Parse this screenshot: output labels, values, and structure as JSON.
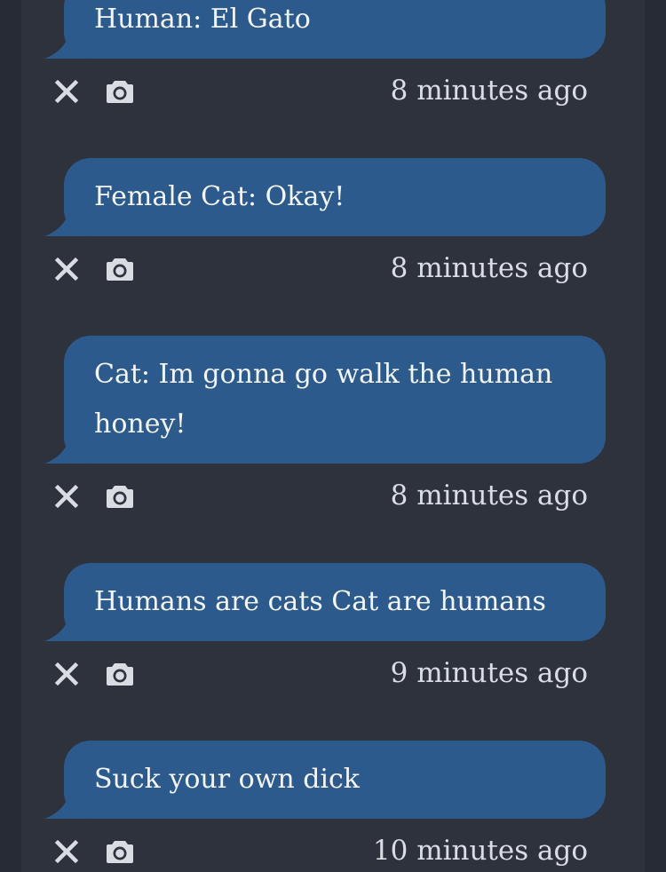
{
  "colors": {
    "background": "#272b35",
    "column": "#2e323d",
    "bubble": "#2c5a8c",
    "message_text": "#f4f5f8",
    "meta_text": "#dadde4",
    "icon": "#d9dce3"
  },
  "icons": {
    "delete": "close-icon",
    "photo": "camera-icon"
  },
  "messages": [
    {
      "text": "Human: El Gato",
      "time": "8 minutes ago"
    },
    {
      "text": "Female Cat: Okay!",
      "time": "8 minutes ago"
    },
    {
      "text": "Cat: Im gonna go walk the human honey!",
      "time": "8 minutes ago"
    },
    {
      "text": "Humans are cats Cat are humans",
      "time": "9 minutes ago"
    },
    {
      "text": "Suck your own dick",
      "time": "10 minutes ago"
    }
  ]
}
